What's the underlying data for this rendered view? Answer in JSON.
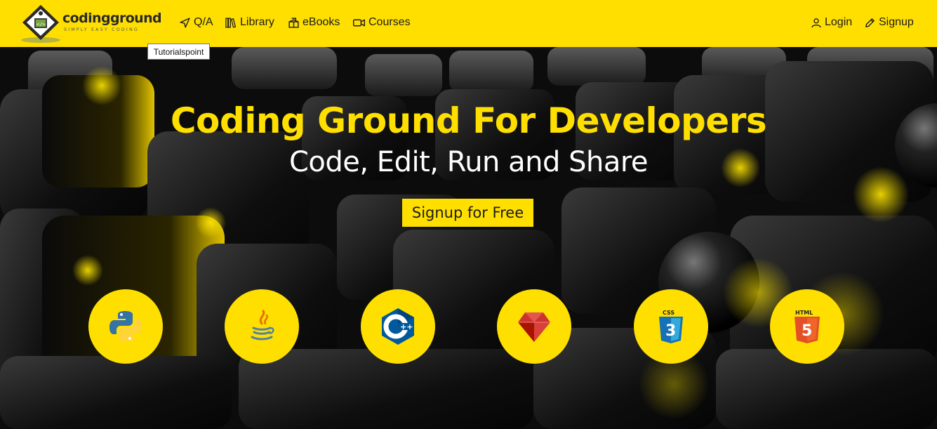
{
  "header": {
    "logo": {
      "wordmark": "codingground",
      "tagline": "SIMPLY EASY CODING"
    },
    "nav": [
      {
        "label": "Q/A",
        "icon": "send-arrow-icon"
      },
      {
        "label": "Library",
        "icon": "library-books-icon"
      },
      {
        "label": "eBooks",
        "icon": "ebook-box-icon"
      },
      {
        "label": "Courses",
        "icon": "video-camera-icon"
      }
    ],
    "auth": [
      {
        "label": "Login",
        "icon": "user-icon"
      },
      {
        "label": "Signup",
        "icon": "pencil-icon"
      }
    ]
  },
  "tooltip": "Tutorialspoint",
  "hero": {
    "title": "Coding Ground For Developers",
    "subtitle": "Code, Edit, Run and Share",
    "cta": "Signup for Free"
  },
  "languages": [
    {
      "icon": "python-icon"
    },
    {
      "icon": "java-icon"
    },
    {
      "icon": "cpp-icon"
    },
    {
      "icon": "ruby-icon"
    },
    {
      "icon": "css3-icon"
    },
    {
      "icon": "html5-icon"
    }
  ],
  "colors": {
    "brand_yellow": "#FFDF00",
    "text_dark": "#1c1c1c",
    "hero_bg": "#0c0c0c"
  }
}
